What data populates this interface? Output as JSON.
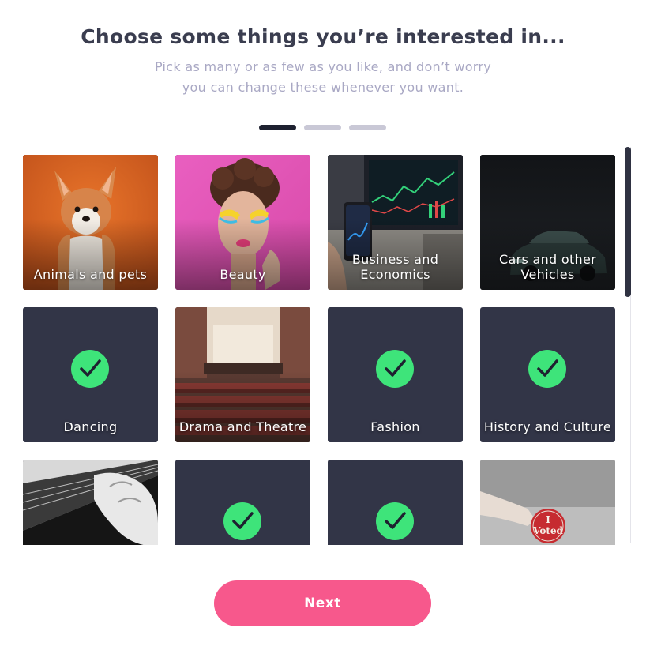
{
  "header": {
    "title": "Choose some things you’re interested in...",
    "subtitle_line1": "Pick as many or as few as you like, and don’t worry",
    "subtitle_line2": "you can change these whenever you want."
  },
  "progress": {
    "total_steps": 3,
    "current_step": 1
  },
  "interests": [
    {
      "label": "Animals and pets",
      "selected": false
    },
    {
      "label": "Beauty",
      "selected": false
    },
    {
      "label": "Business and Economics",
      "selected": false
    },
    {
      "label": "Cars and other Vehicles",
      "selected": false
    },
    {
      "label": "Dancing",
      "selected": true
    },
    {
      "label": "Drama and Theatre",
      "selected": false
    },
    {
      "label": "Fashion",
      "selected": true
    },
    {
      "label": "History and Culture",
      "selected": true
    },
    {
      "label": "",
      "selected": false
    },
    {
      "label": "",
      "selected": true
    },
    {
      "label": "",
      "selected": true
    },
    {
      "label": "",
      "selected": false
    }
  ],
  "voted_sticker": {
    "line1": "I",
    "line2": "Voted"
  },
  "actions": {
    "next_label": "Next"
  },
  "colors": {
    "accent": "#f7588c",
    "check": "#3ee47a",
    "selected_tile": "#323547",
    "title": "#3a3d4f",
    "subtitle": "#a9a8c4"
  }
}
